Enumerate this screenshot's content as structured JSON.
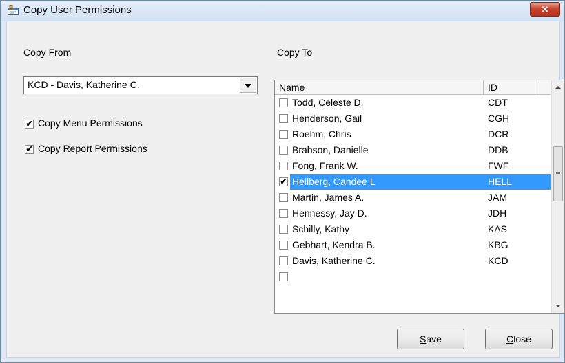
{
  "window": {
    "title": "Copy User Permissions",
    "close_glyph": "✕"
  },
  "copy_from": {
    "label": "Copy From",
    "selected": "KCD - Davis, Katherine C.",
    "options_checkboxes": [
      {
        "label": "Copy Menu Permissions",
        "checked": true
      },
      {
        "label": "Copy Report Permissions",
        "checked": true
      }
    ]
  },
  "copy_to": {
    "label": "Copy To",
    "columns": {
      "name": "Name",
      "id": "ID"
    },
    "rows": [
      {
        "name": "Todd, Celeste D.",
        "id": "CDT",
        "checked": false,
        "selected": false
      },
      {
        "name": "Henderson, Gail",
        "id": "CGH",
        "checked": false,
        "selected": false
      },
      {
        "name": "Roehm, Chris",
        "id": "DCR",
        "checked": false,
        "selected": false
      },
      {
        "name": "Brabson, Danielle",
        "id": "DDB",
        "checked": false,
        "selected": false
      },
      {
        "name": "Fong, Frank W.",
        "id": "FWF",
        "checked": false,
        "selected": false
      },
      {
        "name": "Hellberg, Candee L",
        "id": "HELL",
        "checked": true,
        "selected": true
      },
      {
        "name": "Martin, James A.",
        "id": "JAM",
        "checked": false,
        "selected": false
      },
      {
        "name": "Hennessy, Jay D.",
        "id": "JDH",
        "checked": false,
        "selected": false
      },
      {
        "name": "Schilly, Kathy",
        "id": "KAS",
        "checked": false,
        "selected": false
      },
      {
        "name": "Gebhart, Kendra B.",
        "id": "KBG",
        "checked": false,
        "selected": false
      },
      {
        "name": "Davis, Katherine C.",
        "id": "KCD",
        "checked": false,
        "selected": false
      }
    ]
  },
  "buttons": {
    "save": "Save",
    "close": "Close"
  },
  "colors": {
    "selection": "#3399ff",
    "close_button": "#c7452f"
  },
  "icons": [
    "window-icon",
    "close-icon",
    "dropdown-arrow-icon",
    "checkbox-icon",
    "scroll-up-icon",
    "scroll-down-icon"
  ]
}
